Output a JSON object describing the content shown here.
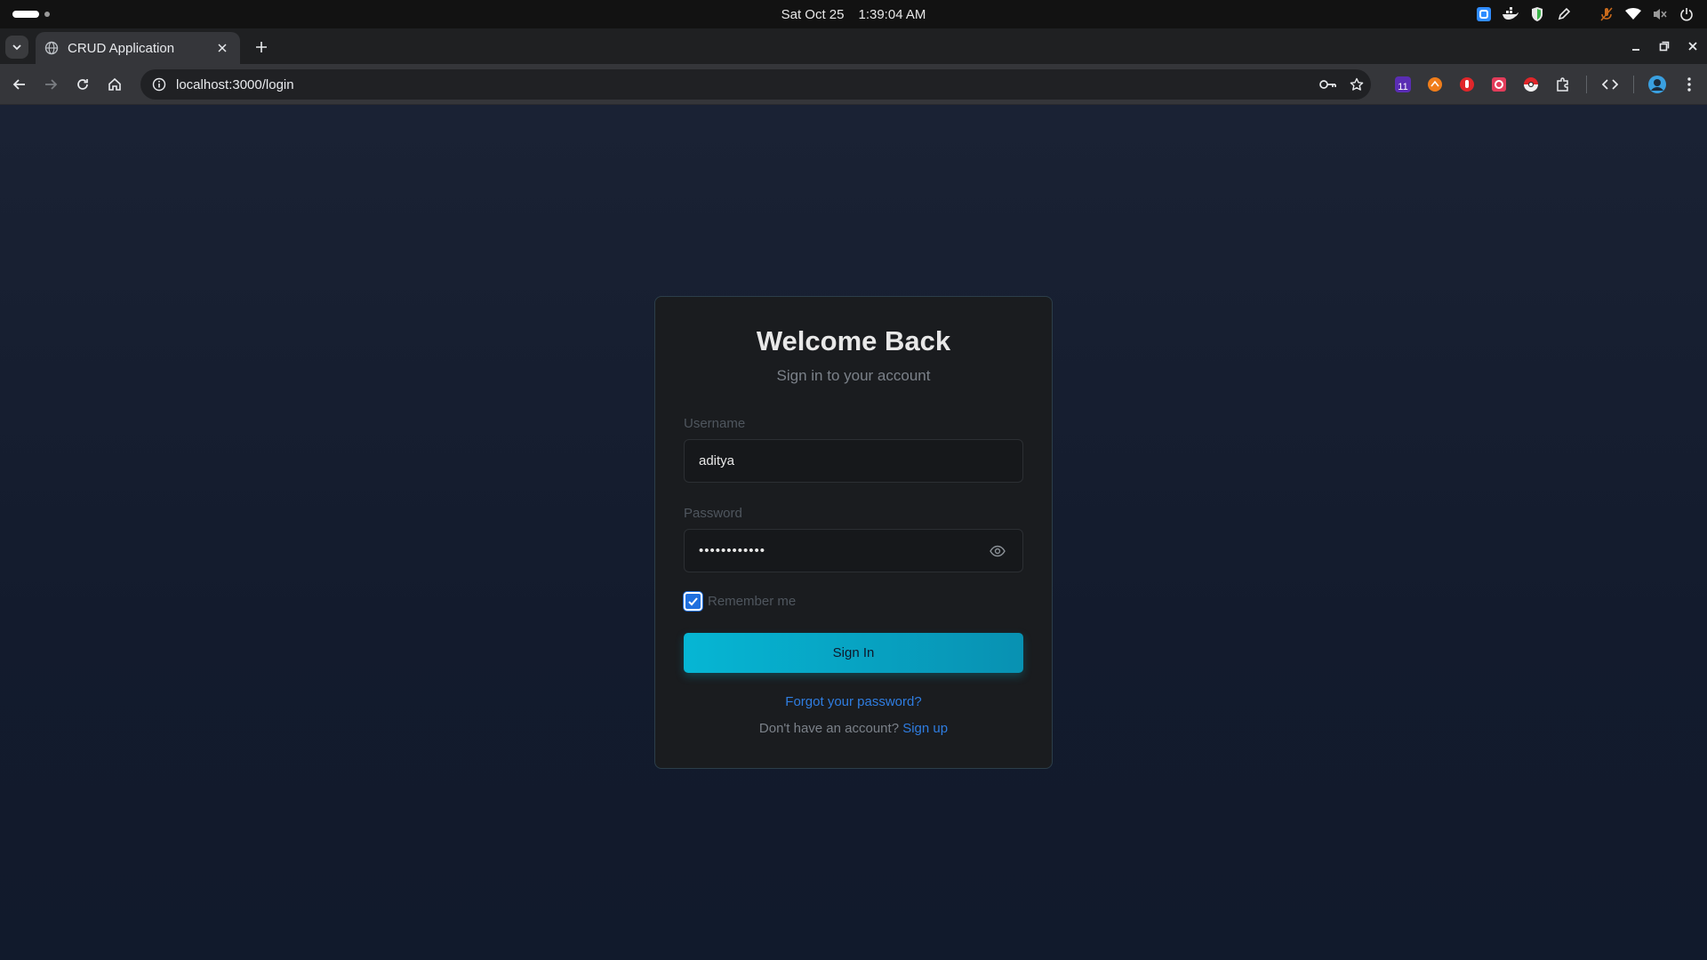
{
  "system_bar": {
    "date": "Sat Oct 25",
    "time": "1:39:04 AM",
    "tray_icons": [
      "app-indicator-icon",
      "docker-icon",
      "shield-icon",
      "pen-icon",
      "mic-muted-icon",
      "wifi-icon",
      "volume-muted-icon",
      "power-icon"
    ]
  },
  "browser": {
    "tab": {
      "title": "CRUD Application",
      "icon": "globe-icon"
    },
    "address": {
      "url": "localhost:3000/login"
    },
    "extensions": {
      "badge_count": "11"
    }
  },
  "login": {
    "title": "Welcome Back",
    "subtitle": "Sign in to your account",
    "username_label": "Username",
    "username_value": "aditya",
    "password_label": "Password",
    "password_masked": "••••••••••••",
    "remember_label": "Remember me",
    "remember_checked": true,
    "signin_label": "Sign In",
    "forgot_label": "Forgot your password?",
    "no_account_text": "Don't have an account?",
    "signup_label": "Sign up"
  },
  "colors": {
    "accent": "#06b6d4",
    "link": "#2f7de1",
    "page_bg": "#131b2d",
    "card_bg": "#1a1c1f"
  }
}
